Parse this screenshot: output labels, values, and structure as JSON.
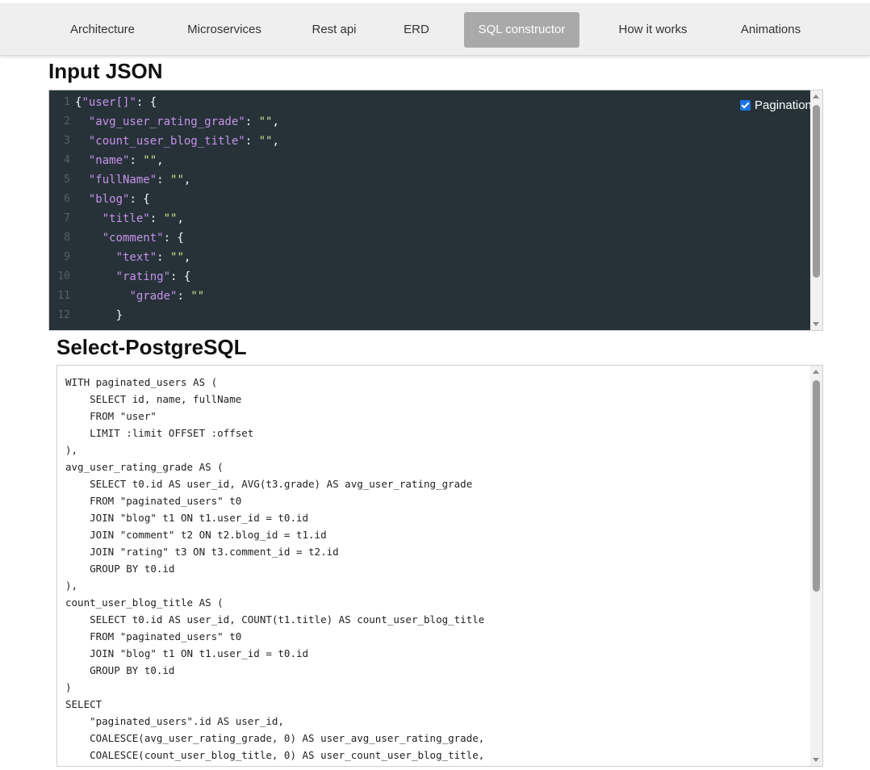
{
  "nav": {
    "items": [
      {
        "label": "Architecture",
        "active": false
      },
      {
        "label": "Microservices",
        "active": false
      },
      {
        "label": "Rest api",
        "active": false
      },
      {
        "label": "ERD",
        "active": false
      },
      {
        "label": "SQL constructor",
        "active": true
      },
      {
        "label": "How it works",
        "active": false
      },
      {
        "label": "Animations",
        "active": false
      }
    ]
  },
  "input_section": {
    "title": "Input JSON",
    "pagination_label": "Pagination",
    "pagination_checked": true,
    "code_lines": [
      {
        "num": "1",
        "indent": "",
        "tokens": [
          {
            "t": "{",
            "c": "punc"
          },
          {
            "t": "\"user[]\"",
            "c": "key"
          },
          {
            "t": ": {",
            "c": "punc"
          }
        ]
      },
      {
        "num": "2",
        "indent": "  ",
        "tokens": [
          {
            "t": "\"avg_user_rating_grade\"",
            "c": "key"
          },
          {
            "t": ": ",
            "c": "punc"
          },
          {
            "t": "\"\"",
            "c": "str"
          },
          {
            "t": ",",
            "c": "punc"
          }
        ]
      },
      {
        "num": "3",
        "indent": "  ",
        "tokens": [
          {
            "t": "\"count_user_blog_title\"",
            "c": "key"
          },
          {
            "t": ": ",
            "c": "punc"
          },
          {
            "t": "\"\"",
            "c": "str"
          },
          {
            "t": ",",
            "c": "punc"
          }
        ]
      },
      {
        "num": "4",
        "indent": "  ",
        "tokens": [
          {
            "t": "\"name\"",
            "c": "key"
          },
          {
            "t": ": ",
            "c": "punc"
          },
          {
            "t": "\"\"",
            "c": "str"
          },
          {
            "t": ",",
            "c": "punc"
          }
        ]
      },
      {
        "num": "5",
        "indent": "  ",
        "tokens": [
          {
            "t": "\"fullName\"",
            "c": "key"
          },
          {
            "t": ": ",
            "c": "punc"
          },
          {
            "t": "\"\"",
            "c": "str"
          },
          {
            "t": ",",
            "c": "punc"
          }
        ]
      },
      {
        "num": "6",
        "indent": "  ",
        "tokens": [
          {
            "t": "\"blog\"",
            "c": "key"
          },
          {
            "t": ": {",
            "c": "punc"
          }
        ]
      },
      {
        "num": "7",
        "indent": "    ",
        "tokens": [
          {
            "t": "\"title\"",
            "c": "key"
          },
          {
            "t": ": ",
            "c": "punc"
          },
          {
            "t": "\"\"",
            "c": "str"
          },
          {
            "t": ",",
            "c": "punc"
          }
        ]
      },
      {
        "num": "8",
        "indent": "    ",
        "tokens": [
          {
            "t": "\"comment\"",
            "c": "key"
          },
          {
            "t": ": {",
            "c": "punc"
          }
        ]
      },
      {
        "num": "9",
        "indent": "      ",
        "tokens": [
          {
            "t": "\"text\"",
            "c": "key"
          },
          {
            "t": ": ",
            "c": "punc"
          },
          {
            "t": "\"\"",
            "c": "str"
          },
          {
            "t": ",",
            "c": "punc"
          }
        ]
      },
      {
        "num": "10",
        "indent": "      ",
        "tokens": [
          {
            "t": "\"rating\"",
            "c": "key"
          },
          {
            "t": ": {",
            "c": "punc"
          }
        ]
      },
      {
        "num": "11",
        "indent": "        ",
        "tokens": [
          {
            "t": "\"grade\"",
            "c": "key"
          },
          {
            "t": ": ",
            "c": "punc"
          },
          {
            "t": "\"\"",
            "c": "str"
          }
        ]
      },
      {
        "num": "12",
        "indent": "      ",
        "tokens": [
          {
            "t": "}",
            "c": "punc"
          }
        ]
      }
    ]
  },
  "sql_section": {
    "title": "Select-PostgreSQL",
    "lines": [
      "WITH paginated_users AS (",
      "    SELECT id, name, fullName",
      "    FROM \"user\"",
      "    LIMIT :limit OFFSET :offset",
      "),",
      "avg_user_rating_grade AS (",
      "    SELECT t0.id AS user_id, AVG(t3.grade) AS avg_user_rating_grade",
      "    FROM \"paginated_users\" t0",
      "    JOIN \"blog\" t1 ON t1.user_id = t0.id",
      "    JOIN \"comment\" t2 ON t2.blog_id = t1.id",
      "    JOIN \"rating\" t3 ON t3.comment_id = t2.id",
      "    GROUP BY t0.id",
      "),",
      "count_user_blog_title AS (",
      "    SELECT t0.id AS user_id, COUNT(t1.title) AS count_user_blog_title",
      "    FROM \"paginated_users\" t0",
      "    JOIN \"blog\" t1 ON t1.user_id = t0.id",
      "    GROUP BY t0.id",
      ")",
      "SELECT",
      "    \"paginated_users\".id AS user_id,",
      "    COALESCE(avg_user_rating_grade, 0) AS user_avg_user_rating_grade,",
      "    COALESCE(count_user_blog_title, 0) AS user_count_user_blog_title,"
    ]
  },
  "colors": {
    "editor_bg": "#263238",
    "json_key": "#c792ea",
    "json_string": "#c3e88d",
    "nav_active_bg": "#a9a9a9",
    "nav_bg": "#efefef"
  },
  "icons": {
    "scroll_up": "triangle-up",
    "scroll_down": "triangle-down",
    "checkbox": "checked-checkbox"
  }
}
